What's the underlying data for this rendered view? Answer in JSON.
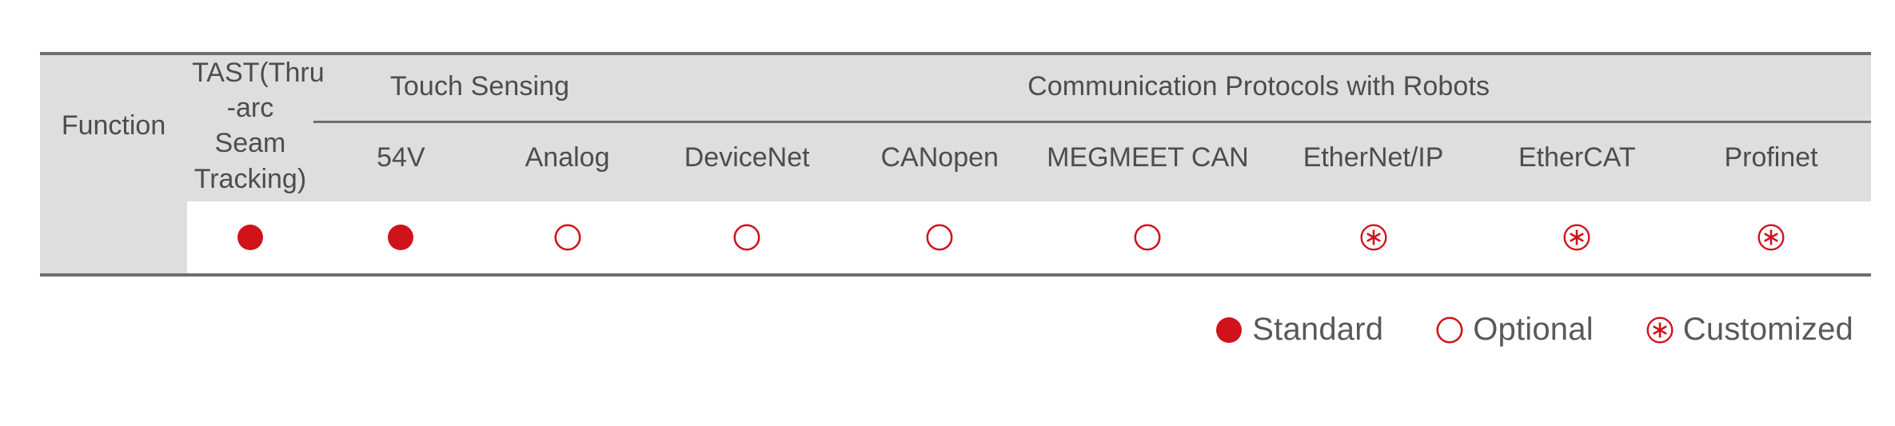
{
  "colors": {
    "accent_red": "#d0121b",
    "header_bg": "#dedede",
    "rule": "#6e6e6e",
    "text_gray": "#4d4d4d",
    "legend_text": "#595959",
    "cell_bg": "#ffffff"
  },
  "table": {
    "row_header_label": "Function",
    "columns": [
      {
        "id": "tast",
        "group": "",
        "label": "TAST(Thru -arc Seam Tracking)"
      },
      {
        "id": "54v",
        "group": "Touch Sensing",
        "label": "54V"
      },
      {
        "id": "analog",
        "group": "Touch Sensing",
        "label": "Analog"
      },
      {
        "id": "devicenet",
        "group": "Communication Protocols with Robots",
        "label": "DeviceNet"
      },
      {
        "id": "canopen",
        "group": "Communication Protocols with Robots",
        "label": "CANopen"
      },
      {
        "id": "megmeetcan",
        "group": "Communication Protocols with Robots",
        "label": "MEGMEET CAN"
      },
      {
        "id": "ethernetip",
        "group": "Communication Protocols with Robots",
        "label": "EtherNet/IP"
      },
      {
        "id": "ethercat",
        "group": "Communication Protocols with Robots",
        "label": "EtherCAT"
      },
      {
        "id": "profinet",
        "group": "Communication Protocols with Robots",
        "label": "Profinet"
      }
    ],
    "groups": [
      {
        "id": "touch",
        "label": "Touch Sensing",
        "span": 2
      },
      {
        "id": "comm",
        "label": "Communication Protocols with Robots",
        "span": 6
      }
    ],
    "group_labels": {
      "touch": "Touch Sensing",
      "comm": "Communication Protocols with Robots"
    },
    "sub_labels": {
      "tast_line1": "TAST(Thru",
      "tast_line2": "-arc Seam",
      "tast_line3": "Tracking)",
      "54v": "54V",
      "analog": "Analog",
      "devicenet": "DeviceNet",
      "canopen": "CANopen",
      "megmeetcan": "MEGMEET CAN",
      "ethernetip": "EtherNet/IP",
      "ethercat": "EtherCAT",
      "profinet": "Profinet"
    },
    "data_row": {
      "tast": "standard",
      "54v": "standard",
      "analog": "optional",
      "devicenet": "optional",
      "canopen": "optional",
      "megmeetcan": "optional",
      "ethernetip": "customized",
      "ethercat": "customized",
      "profinet": "customized"
    }
  },
  "legend": {
    "items": [
      {
        "id": "standard",
        "symbol": "filled-circle",
        "label": "Standard"
      },
      {
        "id": "optional",
        "symbol": "hollow-circle",
        "label": "Optional"
      },
      {
        "id": "customized",
        "symbol": "asterisk-circle",
        "label": "Customized"
      }
    ],
    "standard_label": "Standard",
    "optional_label": "Optional",
    "customized_label": "Customized"
  }
}
